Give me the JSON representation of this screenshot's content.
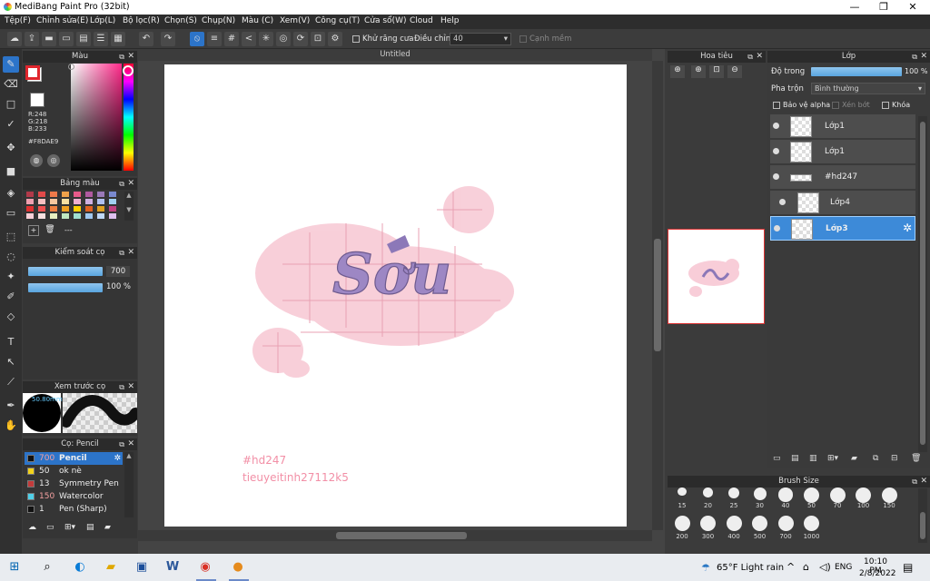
{
  "window": {
    "title": "MediBang Paint Pro (32bit)",
    "minimize": "—",
    "maximize": "❐",
    "close": "✕"
  },
  "menu": [
    "Tệp(F)",
    "Chỉnh sửa(E)",
    "Lớp(L)",
    "Bộ lọc(R)",
    "Chọn(S)",
    "Chụp(N)",
    "Màu (C)",
    "Xem(V)",
    "Công cụ(T)",
    "Cửa sổ(W)",
    "Cloud",
    "Help"
  ],
  "toolbar": {
    "antialias": "Khử răng cưa",
    "adjust_label": "Điều chỉnh",
    "adjust_value": "40",
    "smooth": "Cạnh mềm"
  },
  "color_panel": {
    "title": "Màu",
    "r": "R:248",
    "g": "G:218",
    "b": "B:233",
    "hex": "#F8DAE9"
  },
  "palette_panel": {
    "title": "Bảng màu",
    "more": "---"
  },
  "brush_control": {
    "title": "Kiểm soát cọ",
    "size": "700",
    "opacity": "100 %"
  },
  "brush_preview": {
    "title": "Xem trước cọ",
    "size": "50.80mm"
  },
  "brush_list": {
    "title": "Cọ: Pencil",
    "items": [
      {
        "size": "700",
        "name": "Pencil",
        "color": "#111111"
      },
      {
        "size": "50",
        "name": "ok nè",
        "color": "#f2d21b"
      },
      {
        "size": "13",
        "name": "Symmetry Pen",
        "color": "#c33b3b"
      },
      {
        "size": "150",
        "name": "Watercolor",
        "color": "#4fd0e8"
      },
      {
        "size": "1",
        "name": "Pen (Sharp)",
        "color": "#111111"
      }
    ]
  },
  "canvas": {
    "tab": "Untitled",
    "title_text": "Sơu",
    "note1": "#hd247",
    "note2": "tieuyeitinh27112k5"
  },
  "navigator": {
    "title": "Hoa tiêu"
  },
  "layers_panel": {
    "title": "Lớp",
    "opacity_label": "Độ trong",
    "opacity_value": "100 %",
    "blend_label": "Pha trộn",
    "blend_value": "Bình thường",
    "protect_alpha": "Bảo vệ alpha",
    "clip": "Xén bớt",
    "lock": "Khóa",
    "layers": [
      "Lớp1",
      "Lớp1",
      "#hd247",
      "Lớp4",
      "Lớp3"
    ]
  },
  "brush_size": {
    "title": "Brush Size",
    "row1": [
      "15",
      "20",
      "25",
      "30",
      "40",
      "50",
      "70",
      "100",
      "150"
    ],
    "row2": [
      "200",
      "300",
      "400",
      "500",
      "700",
      "1000"
    ]
  },
  "taskbar": {
    "weather": "65°F  Light rain",
    "lang": "ENG",
    "time": "10:10 PM",
    "date": "2/8/2022"
  }
}
